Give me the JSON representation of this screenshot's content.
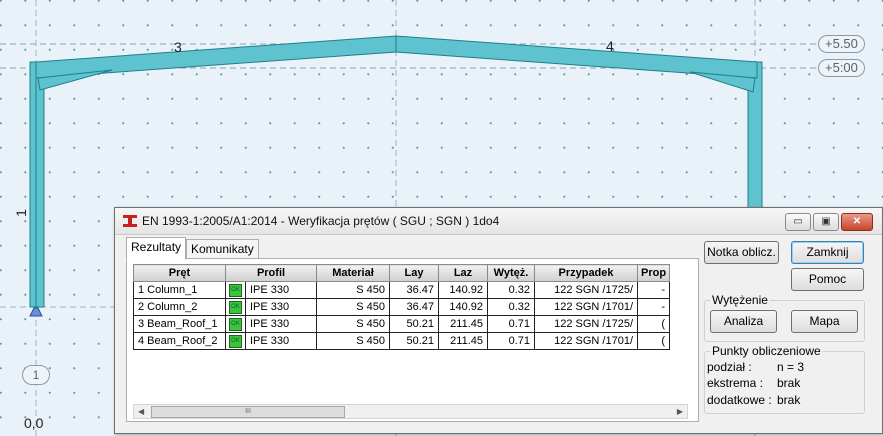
{
  "canvas": {
    "bar_labels": [
      "3",
      "4",
      "1"
    ],
    "levels": [
      "+5.50",
      "+5:00"
    ],
    "node_label": "1",
    "origin_label": "0,0"
  },
  "dialog": {
    "title": "EN 1993-1:2005/A1:2014 - Weryfikacja prętów ( SGU ; SGN ) 1do4",
    "window_buttons": {
      "minimize": "▭",
      "maximize": "▣",
      "close": "✕"
    },
    "tabs": [
      "Rezultaty",
      "Komunikaty"
    ],
    "table": {
      "columns": [
        "Pręt",
        "Profil",
        "Materiał",
        "Lay",
        "Laz",
        "Wytęż.",
        "Przypadek",
        "Prop"
      ],
      "ok_label": "OK",
      "rows": [
        {
          "pret": "1  Column_1",
          "profil": "IPE 330",
          "material": "S 450",
          "lay": "36.47",
          "laz": "140.92",
          "wytez": "0.32",
          "przypadek": "122 SGN /1725/",
          "prop": "-"
        },
        {
          "pret": "2  Column_2",
          "profil": "IPE 330",
          "material": "S 450",
          "lay": "36.47",
          "laz": "140.92",
          "wytez": "0.32",
          "przypadek": "122 SGN /1701/",
          "prop": "-"
        },
        {
          "pret": "3  Beam_Roof_1",
          "profil": "IPE 330",
          "material": "S 450",
          "lay": "50.21",
          "laz": "211.45",
          "wytez": "0.71",
          "przypadek": "122 SGN /1725/",
          "prop": "("
        },
        {
          "pret": "4  Beam_Roof_2",
          "profil": "IPE 330",
          "material": "S 450",
          "lay": "50.21",
          "laz": "211.45",
          "wytez": "0.71",
          "przypadek": "122 SGN /1701/",
          "prop": "("
        }
      ]
    },
    "scrollbar": {
      "left": "◀",
      "right": "▶",
      "grip": "III"
    },
    "buttons": {
      "notka": "Notka oblicz.",
      "zamknij": "Zamknij",
      "pomoc": "Pomoc",
      "analiza": "Analiza",
      "mapa": "Mapa"
    },
    "wytezenie_group": {
      "title": "Wytężenie"
    },
    "punkty_group": {
      "title": "Punkty obliczeniowe",
      "rows": [
        {
          "label": "podział :",
          "value": "n = 3"
        },
        {
          "label": "ekstrema :",
          "value": "brak"
        },
        {
          "label": "dodatkowe :",
          "value": "brak"
        }
      ]
    }
  }
}
